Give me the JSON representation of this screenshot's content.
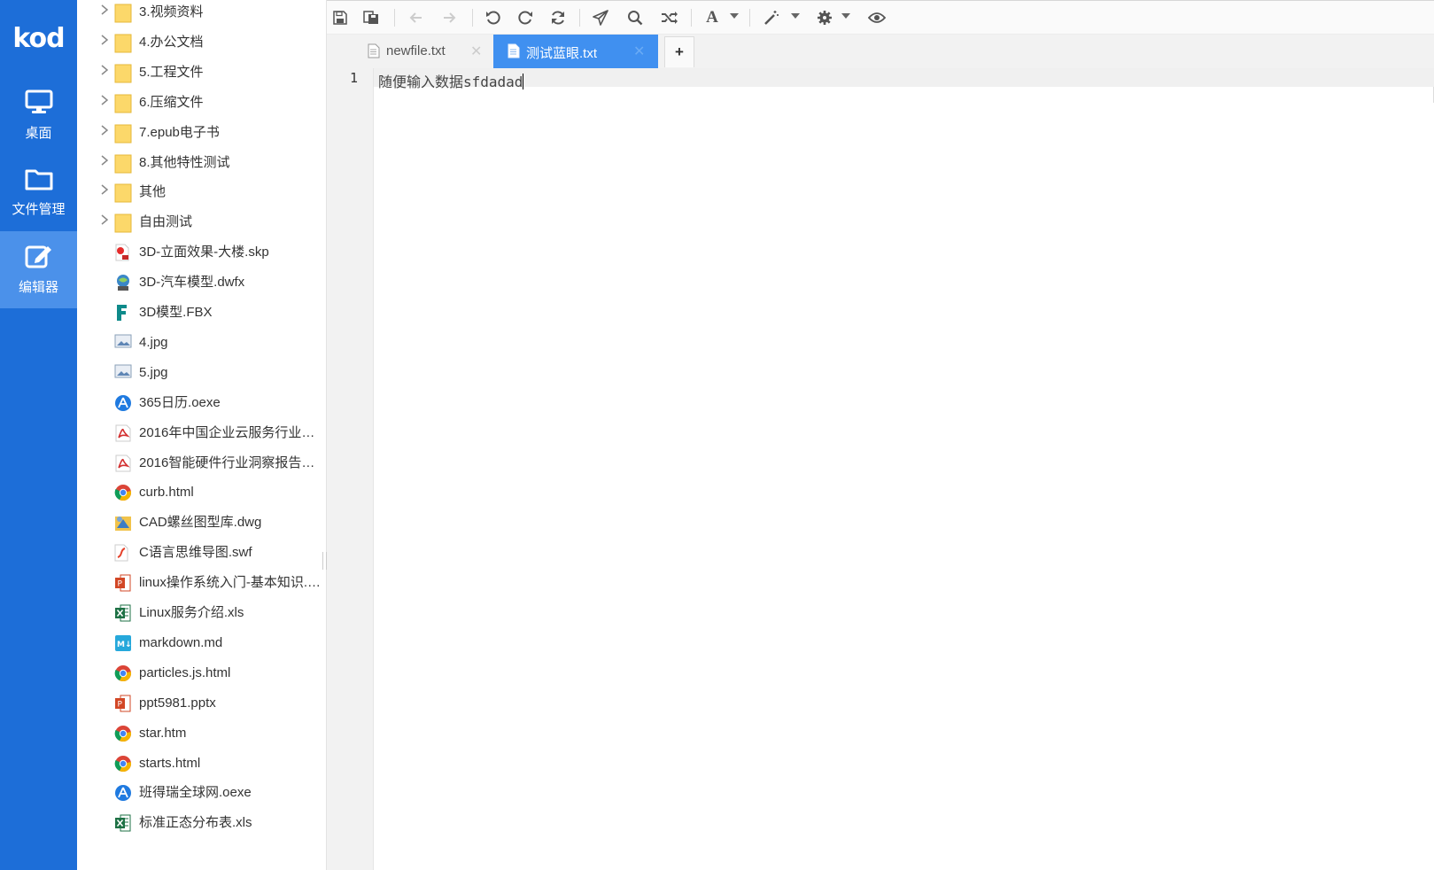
{
  "app": {
    "logo_text": "kod",
    "brand_color": "#1d6ed8",
    "nav": [
      {
        "label": "桌面",
        "icon": "monitor-icon",
        "active": false
      },
      {
        "label": "文件管理",
        "icon": "folder-icon",
        "active": false
      },
      {
        "label": "编辑器",
        "icon": "edit-icon",
        "active": true
      }
    ]
  },
  "tree": {
    "items": [
      {
        "name": "3.视频资料",
        "type": "folder"
      },
      {
        "name": "4.办公文档",
        "type": "folder"
      },
      {
        "name": "5.工程文件",
        "type": "folder"
      },
      {
        "name": "6.压缩文件",
        "type": "folder"
      },
      {
        "name": "7.epub电子书",
        "type": "folder"
      },
      {
        "name": "8.其他特性测试",
        "type": "folder"
      },
      {
        "name": "其他",
        "type": "folder"
      },
      {
        "name": "自由测试",
        "type": "folder"
      },
      {
        "name": "3D-立面效果-大楼.skp",
        "type": "skp"
      },
      {
        "name": "3D-汽车模型.dwfx",
        "type": "dwfx"
      },
      {
        "name": "3D模型.FBX",
        "type": "fbx"
      },
      {
        "name": "4.jpg",
        "type": "image"
      },
      {
        "name": "5.jpg",
        "type": "image"
      },
      {
        "name": "365日历.oexe",
        "type": "oexe"
      },
      {
        "name": "2016年中国企业云服务行业…",
        "type": "pdf"
      },
      {
        "name": "2016智能硬件行业洞察报告…",
        "type": "pdf"
      },
      {
        "name": "curb.html",
        "type": "html"
      },
      {
        "name": "CAD螺丝图型库.dwg",
        "type": "dwg"
      },
      {
        "name": "C语言思维导图.swf",
        "type": "swf"
      },
      {
        "name": "linux操作系统入门-基本知识.…",
        "type": "ppt"
      },
      {
        "name": "Linux服务介绍.xls",
        "type": "xls"
      },
      {
        "name": "markdown.md",
        "type": "md"
      },
      {
        "name": "particles.js.html",
        "type": "html"
      },
      {
        "name": "ppt5981.pptx",
        "type": "ppt"
      },
      {
        "name": "star.htm",
        "type": "html"
      },
      {
        "name": "starts.html",
        "type": "html"
      },
      {
        "name": "班得瑞全球网.oexe",
        "type": "oexe"
      },
      {
        "name": "标准正态分布表.xls",
        "type": "xls"
      }
    ]
  },
  "editor": {
    "toolbar": [
      "save-icon",
      "save-all-icon",
      "back-icon",
      "forward-icon",
      "undo-icon",
      "redo-icon",
      "refresh-icon",
      "send-icon",
      "search-icon",
      "random-icon",
      "font-icon",
      "magic-wand-icon",
      "gear-icon",
      "eye-icon"
    ],
    "tabs": [
      {
        "label": "newfile.txt",
        "active": false
      },
      {
        "label": "测试蓝眼.txt",
        "active": true
      }
    ],
    "add_tab_label": "+",
    "lines": [
      {
        "number": "1",
        "text": "随便输入数据sfdadad"
      }
    ]
  }
}
